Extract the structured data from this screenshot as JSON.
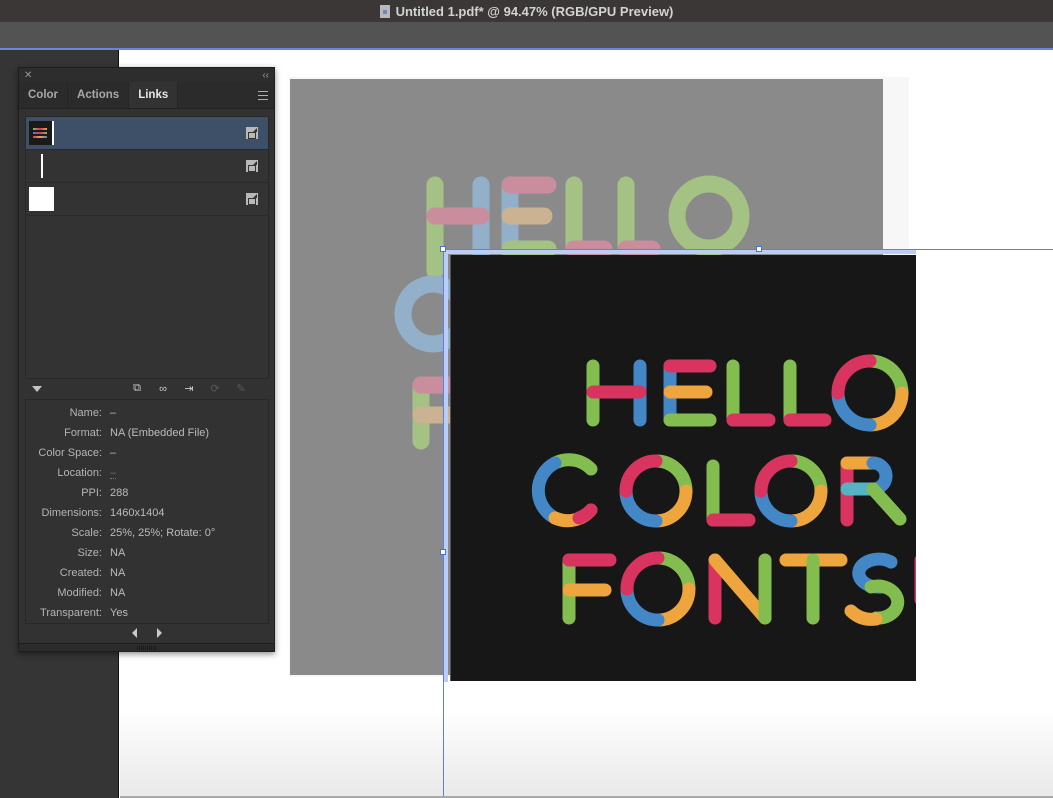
{
  "window": {
    "title": "Untitled 1.pdf* @ 94.47% (RGB/GPU Preview)",
    "doc_icon": "document-icon"
  },
  "panel": {
    "close_icon": "close-icon",
    "collapse_icon": "collapse-icon",
    "tabs": [
      {
        "label": "Color",
        "active": false
      },
      {
        "label": "Actions",
        "active": false
      },
      {
        "label": "Links",
        "active": true
      }
    ],
    "menu_icon": "hamburger-menu-icon",
    "links": [
      {
        "thumbnail": "hello-color-fonts-artwork",
        "selected": true,
        "action_icon": "go-to-link-icon"
      },
      {
        "thumbnail": "vertical-line",
        "selected": false,
        "action_icon": "go-to-link-icon"
      },
      {
        "thumbnail": "white-box",
        "selected": false,
        "action_icon": "go-to-link-icon"
      }
    ],
    "action_icons": [
      {
        "name": "relink-from-library-icon",
        "glyph": "⧉",
        "enabled": true
      },
      {
        "name": "relink-icon",
        "glyph": "∞",
        "enabled": true
      },
      {
        "name": "go-to-linked-file-icon",
        "glyph": "⇥",
        "enabled": true
      },
      {
        "name": "update-link-icon",
        "glyph": "⟳",
        "enabled": false
      },
      {
        "name": "edit-original-icon",
        "glyph": "✎",
        "enabled": false
      }
    ],
    "info": [
      {
        "key": "Name:",
        "value": "–"
      },
      {
        "key": "Format:",
        "value": "NA (Embedded File)"
      },
      {
        "key": "Color Space:",
        "value": "–"
      },
      {
        "key": "Location:",
        "value": "–"
      },
      {
        "key": "PPI:",
        "value": "288"
      },
      {
        "key": "Dimensions:",
        "value": "1460x1404"
      },
      {
        "key": "Scale:",
        "value": "25%, 25%; Rotate: 0°"
      },
      {
        "key": "Size:",
        "value": "NA"
      },
      {
        "key": "Created:",
        "value": "NA"
      },
      {
        "key": "Modified:",
        "value": "NA"
      },
      {
        "key": "Transparent:",
        "value": "Yes"
      }
    ],
    "pager": {
      "prev_icon": "previous-arrow-icon",
      "next_icon": "next-arrow-icon"
    }
  },
  "artwork": {
    "lines": [
      "HELLO",
      "COLOR",
      "FONTS!"
    ],
    "colors": {
      "green": "#84bd4f",
      "blue": "#4487c7",
      "pink": "#d8345f",
      "orange": "#eea53d",
      "teal": "#55b3c3",
      "background": "#171717",
      "ghost_background": "#8a8a8a"
    }
  }
}
